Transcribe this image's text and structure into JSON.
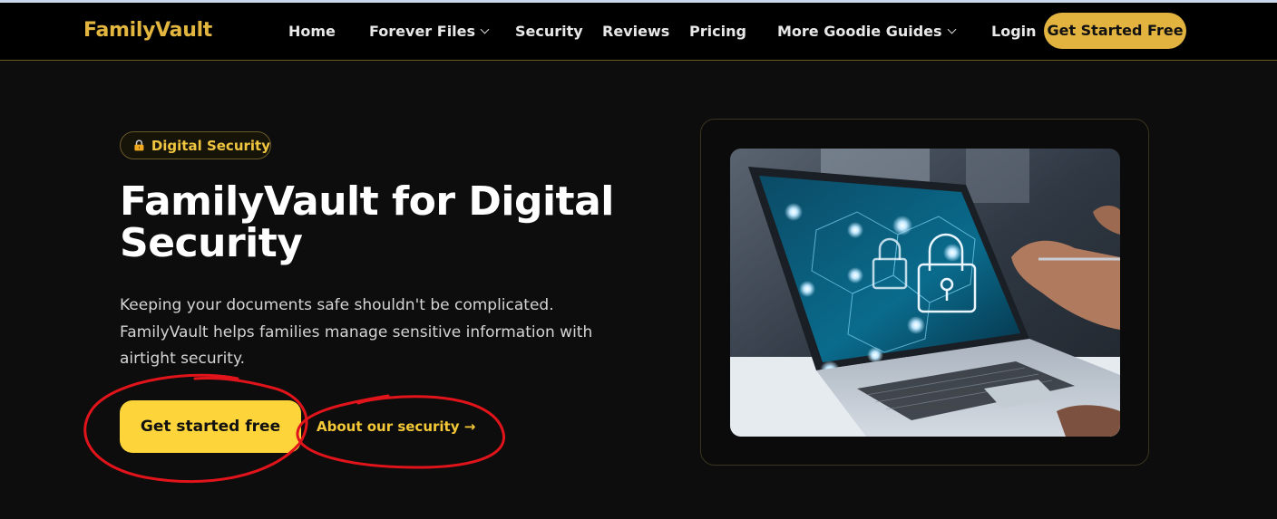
{
  "nav": {
    "logo": "FamilyVault",
    "items": [
      {
        "label": "Home",
        "has_dropdown": false
      },
      {
        "label": "Forever Files",
        "has_dropdown": true
      },
      {
        "label": "Security",
        "has_dropdown": false
      },
      {
        "label": "Reviews",
        "has_dropdown": false
      },
      {
        "label": "Pricing",
        "has_dropdown": false
      },
      {
        "label": "More Goodie Guides",
        "has_dropdown": true
      }
    ],
    "login": "Login",
    "cta": "Get Started Free"
  },
  "hero": {
    "badge": "Digital Security",
    "badge_icon": "lock-icon",
    "title": "FamilyVault for Digital Security",
    "description": "Keeping your documents safe shouldn't be complicated. FamilyVault helps families manage sensitive information with airtight security.",
    "primary_button": "Get started free",
    "secondary_link": "About our security →"
  },
  "colors": {
    "accent": "#e2b33f",
    "primary_button": "#fdd53b",
    "background": "#0d0d0d",
    "annotation": "#e0141a"
  }
}
